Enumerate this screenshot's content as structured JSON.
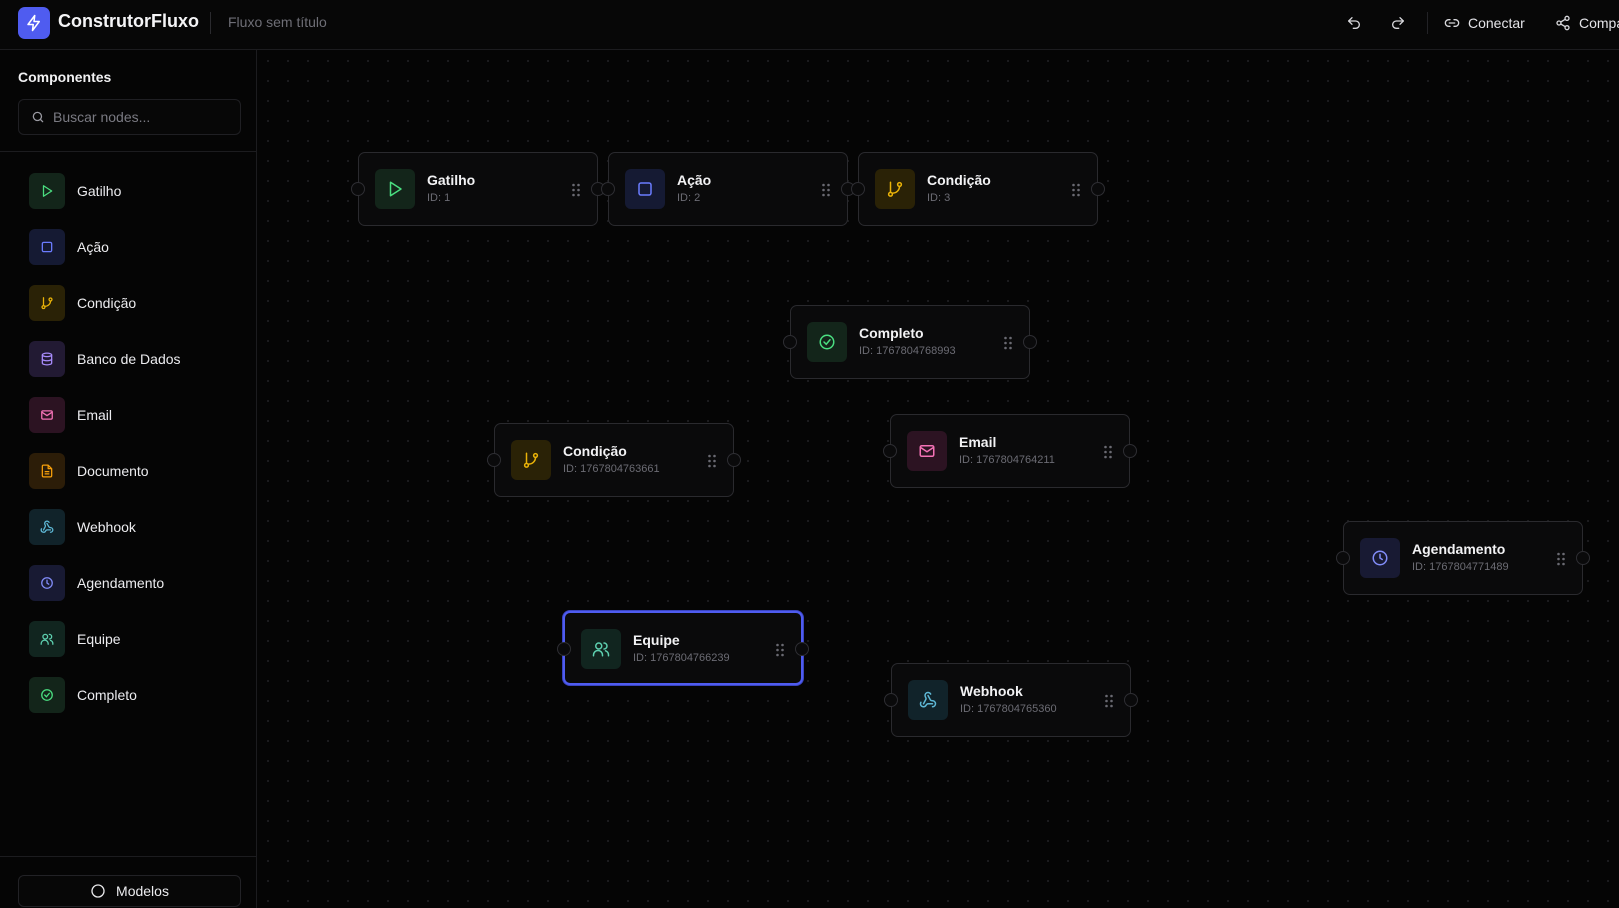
{
  "header": {
    "brand": "ConstrutorFluxo",
    "flow_name": "Fluxo sem título",
    "connect_label": "Conectar",
    "share_label": "Compartilhar",
    "icons": [
      "zap-icon",
      "undo-icon",
      "redo-icon",
      "link-icon",
      "share-icon"
    ]
  },
  "sidebar": {
    "title": "Componentes",
    "search_placeholder": "Buscar nodes...",
    "items": [
      {
        "label": "Gatilho",
        "icon": "play-icon",
        "color": "#4ade80"
      },
      {
        "label": "Ação",
        "icon": "square-icon",
        "color": "#6b7cff"
      },
      {
        "label": "Condição",
        "icon": "git-branch-icon",
        "color": "#eab308"
      },
      {
        "label": "Banco de Dados",
        "icon": "database-icon",
        "color": "#a78bfa"
      },
      {
        "label": "Email",
        "icon": "mail-icon",
        "color": "#f472b6"
      },
      {
        "label": "Documento",
        "icon": "file-text-icon",
        "color": "#f59e0b"
      },
      {
        "label": "Webhook",
        "icon": "webhook-icon",
        "color": "#5eb8d6"
      },
      {
        "label": "Agendamento",
        "icon": "clock-icon",
        "color": "#818cf8"
      },
      {
        "label": "Equipe",
        "icon": "users-icon",
        "color": "#5ed0b0"
      },
      {
        "label": "Completo",
        "icon": "check-circle-icon",
        "color": "#4ade80"
      }
    ],
    "models_label": "Modelos"
  },
  "canvas": {
    "nodes": [
      {
        "title": "Gatilho",
        "id": "ID: 1"
      },
      {
        "title": "Ação",
        "id": "ID: 2"
      },
      {
        "title": "Condição",
        "id": "ID: 3"
      },
      {
        "title": "Completo",
        "id": "ID: 1767804768993"
      },
      {
        "title": "Condição",
        "id": "ID: 1767804763661"
      },
      {
        "title": "Email",
        "id": "ID: 1767804764211"
      },
      {
        "title": "Agendamento",
        "id": "ID: 1767804771489"
      },
      {
        "title": "Equipe",
        "id": "ID: 1767804766239",
        "selected": true
      },
      {
        "title": "Webhook",
        "id": "ID: 1767804765360"
      }
    ]
  },
  "colors": {
    "accent": "#4f5cf0",
    "background": "#050505",
    "border": "#2a2a2e"
  }
}
